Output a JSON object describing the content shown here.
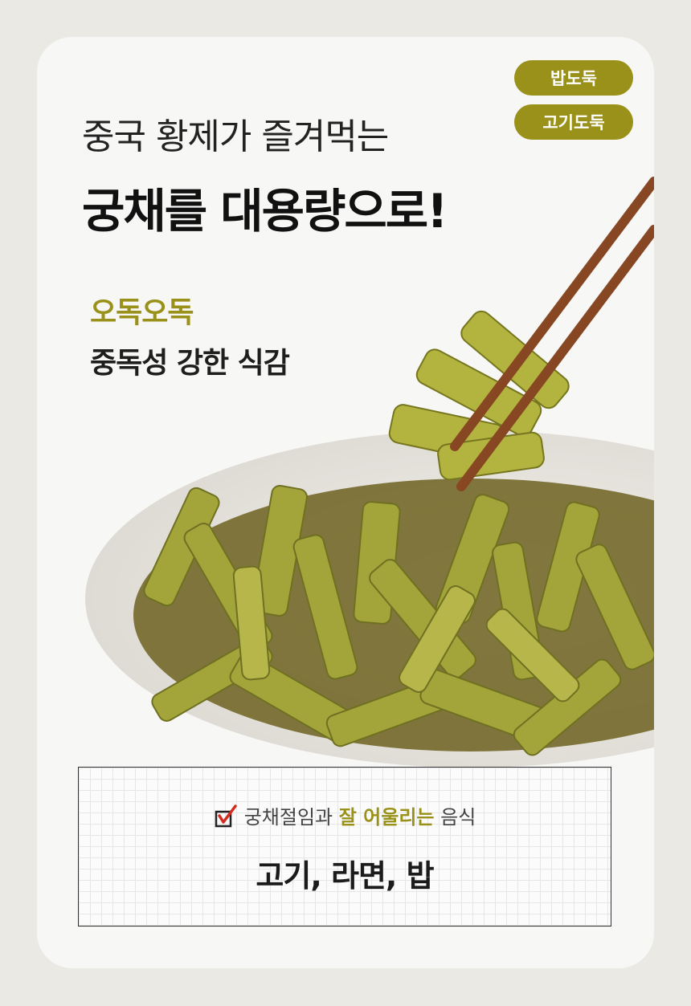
{
  "badges": [
    "밥도둑",
    "고기도둑"
  ],
  "headline": {
    "line1": "중국 황제가 즐겨먹는",
    "line2_pre": "궁채를 ",
    "line2_highlight": "대용량",
    "line2_post": "으로!"
  },
  "texture": {
    "accent": "오독오독",
    "desc": "중독성 강한 식감"
  },
  "pairing": {
    "prefix": "궁채절임과 ",
    "highlight": "잘 어울리는",
    "suffix": " 음식",
    "foods": "고기, 라면, 밥"
  },
  "colors": {
    "accent": "#9a911a",
    "highlight": "#f2ec7a",
    "background": "#eae9e4",
    "card": "#f7f7f5"
  },
  "icons": [
    "checkbox-check-icon"
  ]
}
